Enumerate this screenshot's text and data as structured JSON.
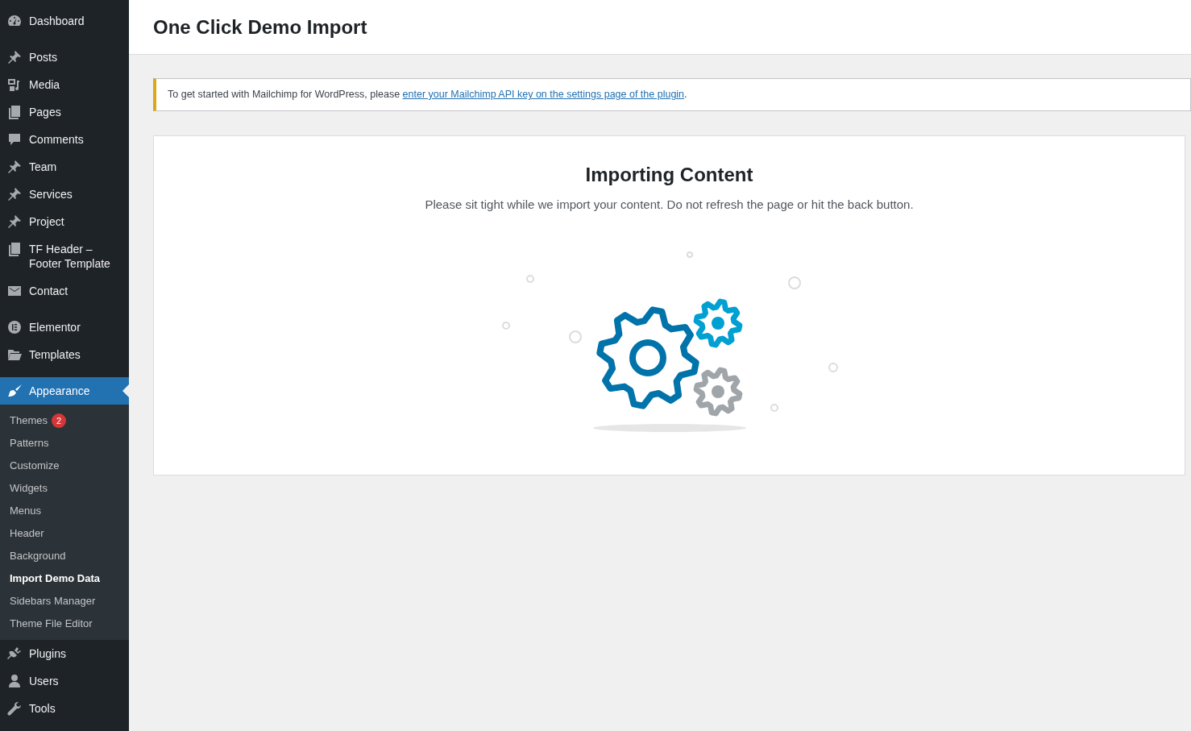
{
  "sidebar": {
    "groups": [
      {
        "items": [
          {
            "label": "Dashboard"
          }
        ]
      },
      {
        "items": [
          {
            "label": "Posts"
          },
          {
            "label": "Media"
          },
          {
            "label": "Pages"
          },
          {
            "label": "Comments"
          },
          {
            "label": "Team"
          },
          {
            "label": "Services"
          },
          {
            "label": "Project"
          },
          {
            "label": "TF Header – Footer Template"
          },
          {
            "label": "Contact"
          }
        ]
      },
      {
        "items": [
          {
            "label": "Elementor"
          },
          {
            "label": "Templates"
          }
        ]
      },
      {
        "items": [
          {
            "label": "Appearance",
            "selected": true,
            "submenu": [
              {
                "label": "Themes",
                "badge": "2",
                "selected": false
              },
              {
                "label": "Patterns",
                "selected": false
              },
              {
                "label": "Customize",
                "selected": false
              },
              {
                "label": "Widgets",
                "selected": false
              },
              {
                "label": "Menus",
                "selected": false
              },
              {
                "label": "Header",
                "selected": false
              },
              {
                "label": "Background",
                "selected": false
              },
              {
                "label": "Import Demo Data",
                "selected": true
              },
              {
                "label": "Sidebars Manager",
                "selected": false
              },
              {
                "label": "Theme File Editor",
                "selected": false
              }
            ]
          },
          {
            "label": "Plugins",
            "selected": false
          },
          {
            "label": "Users",
            "selected": false
          },
          {
            "label": "Tools",
            "selected": false
          }
        ]
      }
    ]
  },
  "page_title": "One Click Demo Import",
  "notice": {
    "text": "To get started with Mailchimp for WordPress, please ",
    "link": "enter your Mailchimp API key on the settings page of the plugin",
    "after": "."
  },
  "import_panel": {
    "heading": "Importing Content",
    "message": "Please sit tight while we import your content. Do not refresh the page or hit the back button."
  }
}
